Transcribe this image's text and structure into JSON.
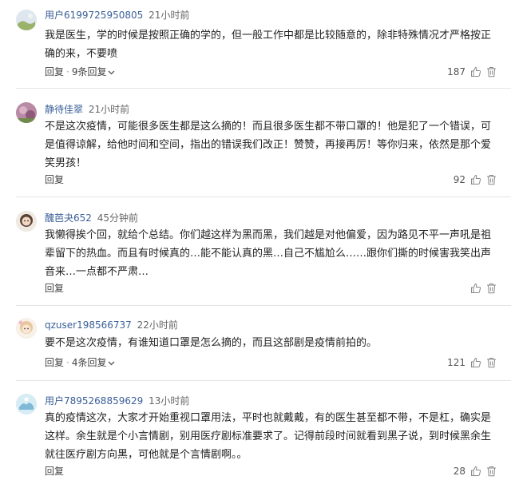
{
  "comments": [
    {
      "username": "用户6199725950805",
      "time": "21小时前",
      "content": "我是医生，学的时候是按照正确的学的，但一般工作中都是比较随意的，除非特殊情况才严格按正确的来，不要喷",
      "reply_label": "回复",
      "replies_label": "9条回复",
      "likes": "187"
    },
    {
      "username": "静待佳翠",
      "time": "21小时前",
      "content": "不是这次疫情，可能很多医生都是这么摘的！而且很多医生都不带口罩的！他是犯了一个错误，可是值得谅解，给他时间和空间，指出的错误我们改正！赞赞，再接再厉！等你归来，依然是那个爱笑男孩！",
      "reply_label": "回复",
      "replies_label": "",
      "likes": "92"
    },
    {
      "username": "醜芭夬652",
      "time": "45分钟前",
      "content": "我懒得挨个回，就给个总结。你们越这样为黑而黑，我们越是对他偏爱，因为路见不平一声吼是祖辈留下的热血。而且有时候真的…能不能认真的黑…自己不尴尬么……跟你们撕的时候害我笑出声音来…一点都不严肃…",
      "reply_label": "回复",
      "replies_label": "",
      "likes": ""
    },
    {
      "username": "qzuser198566737",
      "time": "22小时前",
      "content": "要不是这次疫情，有谁知道口罩是怎么摘的，而且这部剧是疫情前拍的。",
      "reply_label": "回复",
      "replies_label": "4条回复",
      "likes": "121"
    },
    {
      "username": "用户7895268859629",
      "time": "13小时前",
      "content": "真的疫情这次，大家才开始重视口罩用法，平时也就戴戴，有的医生甚至都不带，不是杠，确实是这样。余生就是个小言情剧，别用医疗剧标准要求了。记得前段时间就看到黑子说，到时候黑余生就往医疗剧方向黑，可他就是个言情剧啊。。",
      "reply_label": "回复",
      "replies_label": "",
      "likes": "28"
    }
  ],
  "colors": {
    "username": "#3a5f98",
    "text": "#222222",
    "divider": "#e5e5e5",
    "icon": "#888888"
  },
  "icons": [
    "thumbs-up-icon",
    "trash-icon",
    "chevron-down-icon"
  ]
}
